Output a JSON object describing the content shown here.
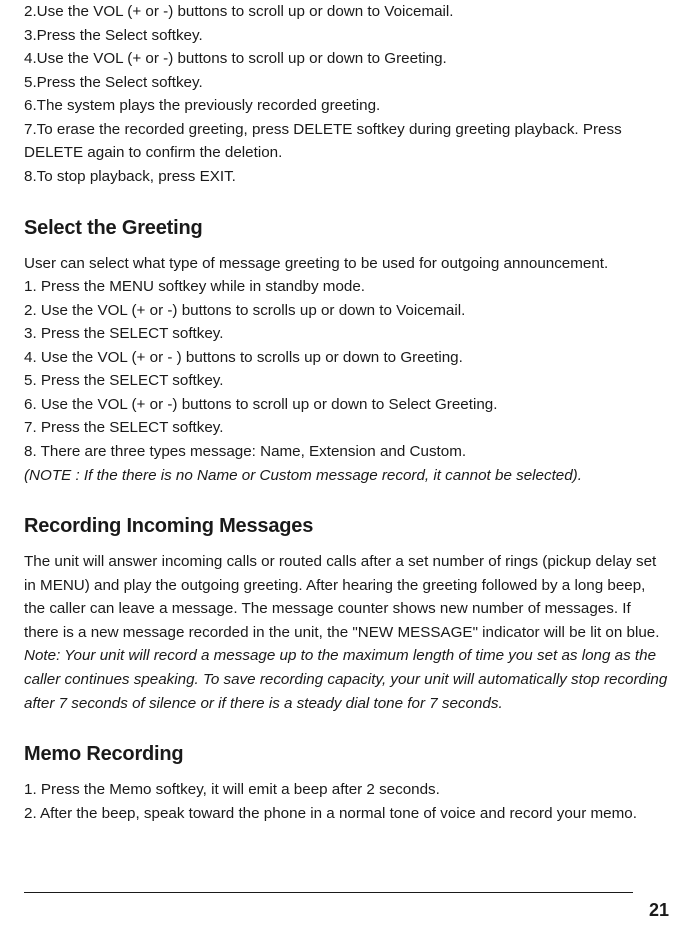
{
  "top_steps": [
    "2.Use the VOL (+ or -) buttons to scroll up or down to Voicemail.",
    "3.Press the Select softkey.",
    "4.Use the VOL (+ or -) buttons to scroll up or down to Greeting.",
    "5.Press the Select softkey.",
    "6.The system plays the previously recorded greeting.",
    "7.To erase the recorded greeting, press DELETE softkey during greeting playback. Press DELETE again to confirm the deletion."
  ],
  "step8": "8.To stop playback, press EXIT.",
  "select_greeting": {
    "title": "Select the Greeting",
    "intro": "User can select what type of message greeting to be used for outgoing announcement.",
    "steps": [
      "1. Press the MENU softkey while in standby mode.",
      "2. Use the VOL (+ or -) buttons to scrolls up or down to Voicemail.",
      "3. Press the SELECT softkey.",
      "4. Use the VOL (+ or - ) buttons to scrolls up or down to Greeting.",
      "5. Press the SELECT softkey.",
      "6. Use the VOL (+ or -) buttons to scroll up or down to Select Greeting.",
      "7. Press the SELECT softkey.",
      "8. There are three types message: Name, Extension and Custom."
    ],
    "note": "(NOTE : If the there is no Name or Custom message record, it cannot be selected)."
  },
  "recording_incoming": {
    "title": "Recording Incoming Messages",
    "body": "The unit will answer incoming calls or routed calls after a set number of rings (pickup delay set in MENU) and play the outgoing greeting. After hearing the greeting followed by a long beep, the caller can leave a message. The message counter shows new number of messages. If there is a new message recorded in the unit, the \"NEW MESSAGE\" indicator will be  lit on blue.",
    "note": "Note: Your unit will record a message up to the maximum length of time you set as long as the caller continues speaking. To save recording capacity, your unit will automatically stop recording after 7 seconds of silence or if there is a steady dial tone for 7 seconds."
  },
  "memo_recording": {
    "title": "Memo Recording",
    "steps": [
      "1. Press the Memo softkey, it will emit a beep after 2 seconds.",
      "2. After the beep, speak toward the phone in a normal tone of voice and record your memo."
    ]
  },
  "page_number": "21"
}
